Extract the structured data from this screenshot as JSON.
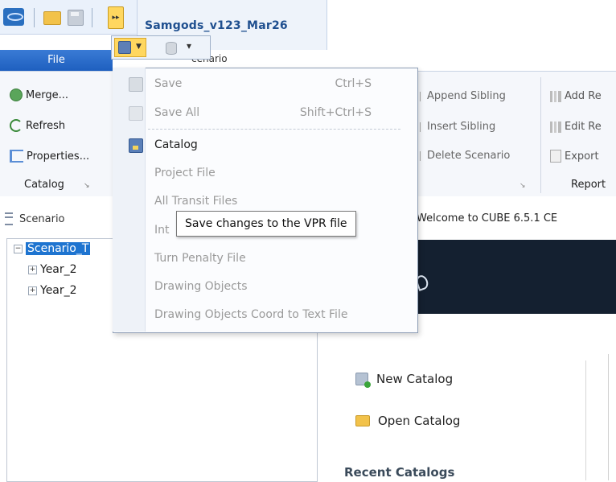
{
  "window": {
    "title": "Samgods_v123_Mar26"
  },
  "file_tab": {
    "label": "File"
  },
  "scenario_tab": {
    "label": "cenario"
  },
  "ribbon": {
    "catalog_group": {
      "buttons": [
        {
          "label": "Merge...",
          "icon": "merge-icon"
        },
        {
          "label": "Refresh",
          "icon": "refresh-icon"
        },
        {
          "label": "Properties...",
          "icon": "properties-icon"
        }
      ],
      "group_label": "Catalog"
    },
    "scenario_group": {
      "buttons": [
        {
          "label": "Append Sibling"
        },
        {
          "label": "Insert Sibling"
        },
        {
          "label": "Delete Scenario"
        }
      ]
    },
    "report_group": {
      "buttons": [
        {
          "label": "Add Re"
        },
        {
          "label": "Edit Re"
        },
        {
          "label": "Export"
        }
      ],
      "group_label": "Report"
    }
  },
  "left_panel": {
    "header": "Scenario",
    "tree": [
      {
        "label": "Scenario_T",
        "selected": true
      },
      {
        "label": "Year_2"
      },
      {
        "label": "Year_2"
      }
    ]
  },
  "right_panel": {
    "tab_label": "Welcome to CUBE 6.5.1 CE",
    "links": [
      {
        "label": "New Catalog",
        "icon": "new-catalog-icon"
      },
      {
        "label": "Open Catalog",
        "icon": "open-folder-icon"
      }
    ],
    "recent_heading": "Recent Catalogs"
  },
  "dropdown_menu": {
    "items": [
      {
        "label": "Save",
        "shortcut": "Ctrl+S",
        "enabled": false,
        "icon": "save-icon"
      },
      {
        "label": "Save All",
        "shortcut": "Shift+Ctrl+S",
        "enabled": false,
        "icon": "save-all-icon"
      },
      {
        "label": "Catalog",
        "shortcut": "",
        "enabled": true,
        "icon": "catalog-save-icon"
      },
      {
        "label": "Project File",
        "shortcut": "",
        "enabled": false
      },
      {
        "label": "All Transit Files",
        "shortcut": "",
        "enabled": false
      },
      {
        "label": "Int",
        "shortcut": "",
        "enabled": false
      },
      {
        "label": "Turn Penalty File",
        "shortcut": "",
        "enabled": false
      },
      {
        "label": "Drawing Objects",
        "shortcut": "",
        "enabled": false
      },
      {
        "label": "Drawing Objects Coord to Text File",
        "shortcut": "",
        "enabled": false
      }
    ]
  },
  "tooltip": {
    "text": "Save changes to the VPR file"
  }
}
